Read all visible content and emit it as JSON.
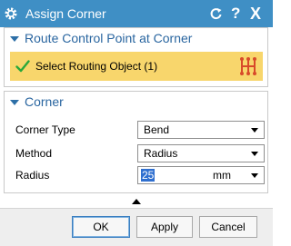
{
  "window": {
    "title": "Assign Corner",
    "help_label": "?",
    "close_label": "X"
  },
  "sections": {
    "route_control": {
      "title": "Route Control Point at Corner",
      "select_label": "Select Routing Object (1)"
    },
    "corner": {
      "title": "Corner",
      "fields": {
        "corner_type": {
          "label": "Corner Type",
          "value": "Bend"
        },
        "method": {
          "label": "Method",
          "value": "Radius"
        },
        "radius": {
          "label": "Radius",
          "value": "25",
          "unit": "mm"
        }
      }
    }
  },
  "buttons": {
    "ok": "OK",
    "apply": "Apply",
    "cancel": "Cancel"
  },
  "colors": {
    "titlebar": "#3f8fc5",
    "section_title": "#2a66a0",
    "selection_highlight": "#f8d66c",
    "check": "#29a83a",
    "tool_icon": "#d84a2a"
  },
  "icons": {
    "title": "gear-icon",
    "reset": "reset-icon",
    "select_status": "check-icon",
    "select_tool": "routing-tool-icon"
  }
}
